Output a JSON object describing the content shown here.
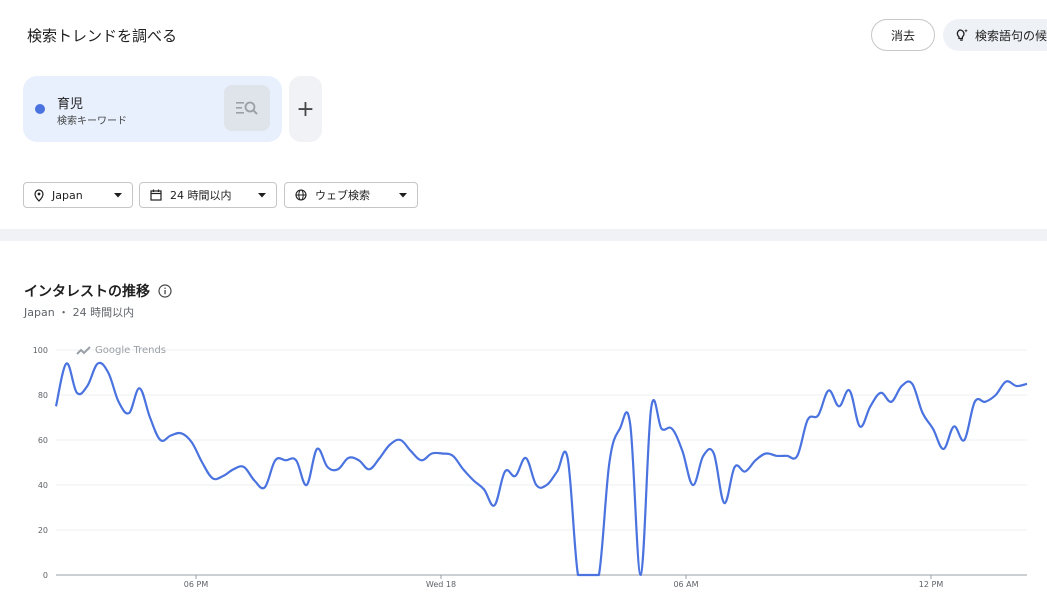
{
  "header": {
    "title": "検索トレンドを調べる",
    "clear_label": "消去",
    "suggest_label": "検索語句の候"
  },
  "term": {
    "name": "育児",
    "type": "検索キーワード",
    "color": "#4a73e0"
  },
  "filters": {
    "location": "Japan",
    "time": "24 時間以内",
    "property": "ウェブ検索"
  },
  "section": {
    "title": "インタレストの推移",
    "subtitle": "Japan ・ 24 時間以内"
  },
  "chart_data": {
    "type": "line",
    "watermark": "Google Trends",
    "ylim": [
      0,
      100
    ],
    "y_ticks": [
      "100",
      "80",
      "60",
      "40",
      "20",
      "0"
    ],
    "x_ticks": [
      "06 PM",
      "Wed 18",
      "06 AM",
      "12 PM"
    ],
    "series": [
      {
        "color": "#4a73e0",
        "values": [
          75,
          94,
          81,
          84,
          94,
          90,
          77,
          72,
          83,
          70,
          60,
          62,
          63,
          59,
          50,
          43,
          44,
          47,
          48,
          42,
          39,
          51,
          51,
          51,
          40,
          56,
          48,
          47,
          52,
          51,
          47,
          52,
          58,
          60,
          55,
          51,
          54,
          54,
          53,
          47,
          42,
          38,
          31,
          46,
          44,
          52,
          40,
          40,
          46,
          52,
          0,
          0,
          0,
          50,
          65,
          67,
          0,
          74,
          65,
          65,
          55,
          40,
          53,
          54,
          32,
          48,
          46,
          51,
          54,
          53,
          53,
          53,
          69,
          71,
          82,
          75,
          82,
          66,
          75,
          81,
          77,
          84,
          85,
          72,
          65,
          56,
          66,
          60,
          77,
          77,
          80,
          86,
          84,
          85
        ]
      }
    ]
  }
}
